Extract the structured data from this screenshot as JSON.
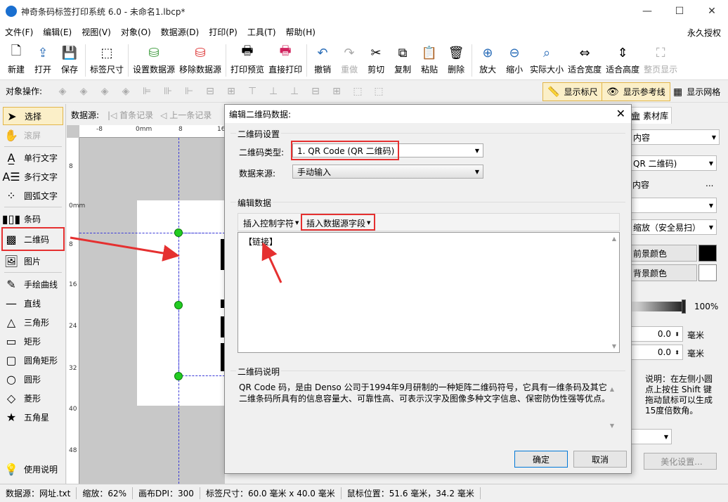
{
  "window": {
    "title": "神奇条码标签打印系统 6.0 - 未命名1.lbcp*",
    "minimize": "—",
    "maximize": "☐",
    "close": "✕"
  },
  "menu": {
    "items": [
      "文件(F)",
      "编辑(E)",
      "视图(V)",
      "对象(O)",
      "数据源(D)",
      "打印(P)",
      "工具(T)",
      "帮助(H)"
    ],
    "license": "永久授权"
  },
  "toolbar": {
    "new": "新建",
    "open": "打开",
    "save": "保存",
    "label_size": "标签尺寸",
    "set_datasource": "设置数据源",
    "remove_datasource": "移除数据源",
    "print_preview": "打印预览",
    "direct_print": "直接打印",
    "undo": "撤销",
    "redo": "重做",
    "cut": "剪切",
    "copy": "复制",
    "paste": "粘贴",
    "delete": "删除",
    "zoom_in": "放大",
    "zoom_out": "缩小",
    "actual_size": "实际大小",
    "fit_width": "适合宽度",
    "fit_height": "适合高度",
    "whole_page": "整页显示"
  },
  "objbar": {
    "label": "对象操作:",
    "show_ruler": "显示标尺",
    "show_guides": "显示参考线",
    "show_grid": "显示网格"
  },
  "tools": {
    "select": "选择",
    "scroll": "滚屏",
    "single_text": "单行文字",
    "multi_text": "多行文字",
    "arc_text": "圆弧文字",
    "barcode": "条码",
    "qrcode": "二维码",
    "image": "图片",
    "freehand": "手绘曲线",
    "line": "直线",
    "triangle": "三角形",
    "rect": "矩形",
    "rounded_rect": "圆角矩形",
    "circle": "圆形",
    "diamond": "菱形",
    "star": "五角星",
    "help": "使用说明"
  },
  "canvas": {
    "datasource_label": "数据源:",
    "first_record": "首条记录",
    "prev_record": "上一条记录",
    "hruler_ticks": [
      "-8",
      "0mm",
      "8",
      "16"
    ],
    "vruler_ticks": [
      "8",
      "0mm",
      "8",
      "16",
      "24",
      "32",
      "40",
      "48"
    ]
  },
  "right_panel": {
    "tab": "素材库",
    "content_combo": "内容",
    "type_combo": "QR 二维码)",
    "content_label": "内容",
    "ellipsis": "...",
    "scale_combo": "缩放（安全易扫）",
    "fg_color_btn": "前景颜色",
    "bg_color_btn": "背景颜色",
    "opacity_value": "100%",
    "x_value": "0.0",
    "y_value": "0.0",
    "unit": "毫米",
    "hint": "说明：在左侧小圆点上按住 Shift 键拖动鼠标可以生成15度倍数角。",
    "beautify": "美化设置...",
    "colors": {
      "fg": "#000000",
      "bg": "#ffffff"
    }
  },
  "status": {
    "datasource": "数据源：网址.txt",
    "zoom": "缩放：62%",
    "dpi": "画布DPI：300",
    "label_size": "标签尺寸：60.0 毫米 x 40.0 毫米",
    "mouse_pos": "鼠标位置：51.6 毫米，34.2 毫米"
  },
  "dialog": {
    "title": "编辑二维码数据:",
    "group_settings": "二维码设置",
    "type_label": "二维码类型:",
    "type_value": "1.  QR Code (QR 二维码)",
    "source_label": "数据来源:",
    "source_value": "手动输入",
    "group_edit": "编辑数据",
    "insert_control": "插入控制字符",
    "insert_field": "插入数据源字段",
    "content": "【链接】",
    "group_desc": "二维码说明",
    "description": "QR Code 码，是由 Denso 公司于1994年9月研制的一种矩阵二维码符号，它具有一维条码及其它二维条码所具有的信息容量大、可靠性高、可表示汉字及图像多种文字信息、保密防伪性强等优点。",
    "ok": "确定",
    "cancel": "取消"
  },
  "colors": {
    "accent_red": "#e53030",
    "handle_green": "#22cc22",
    "guide_blue": "#3a3ad8"
  }
}
